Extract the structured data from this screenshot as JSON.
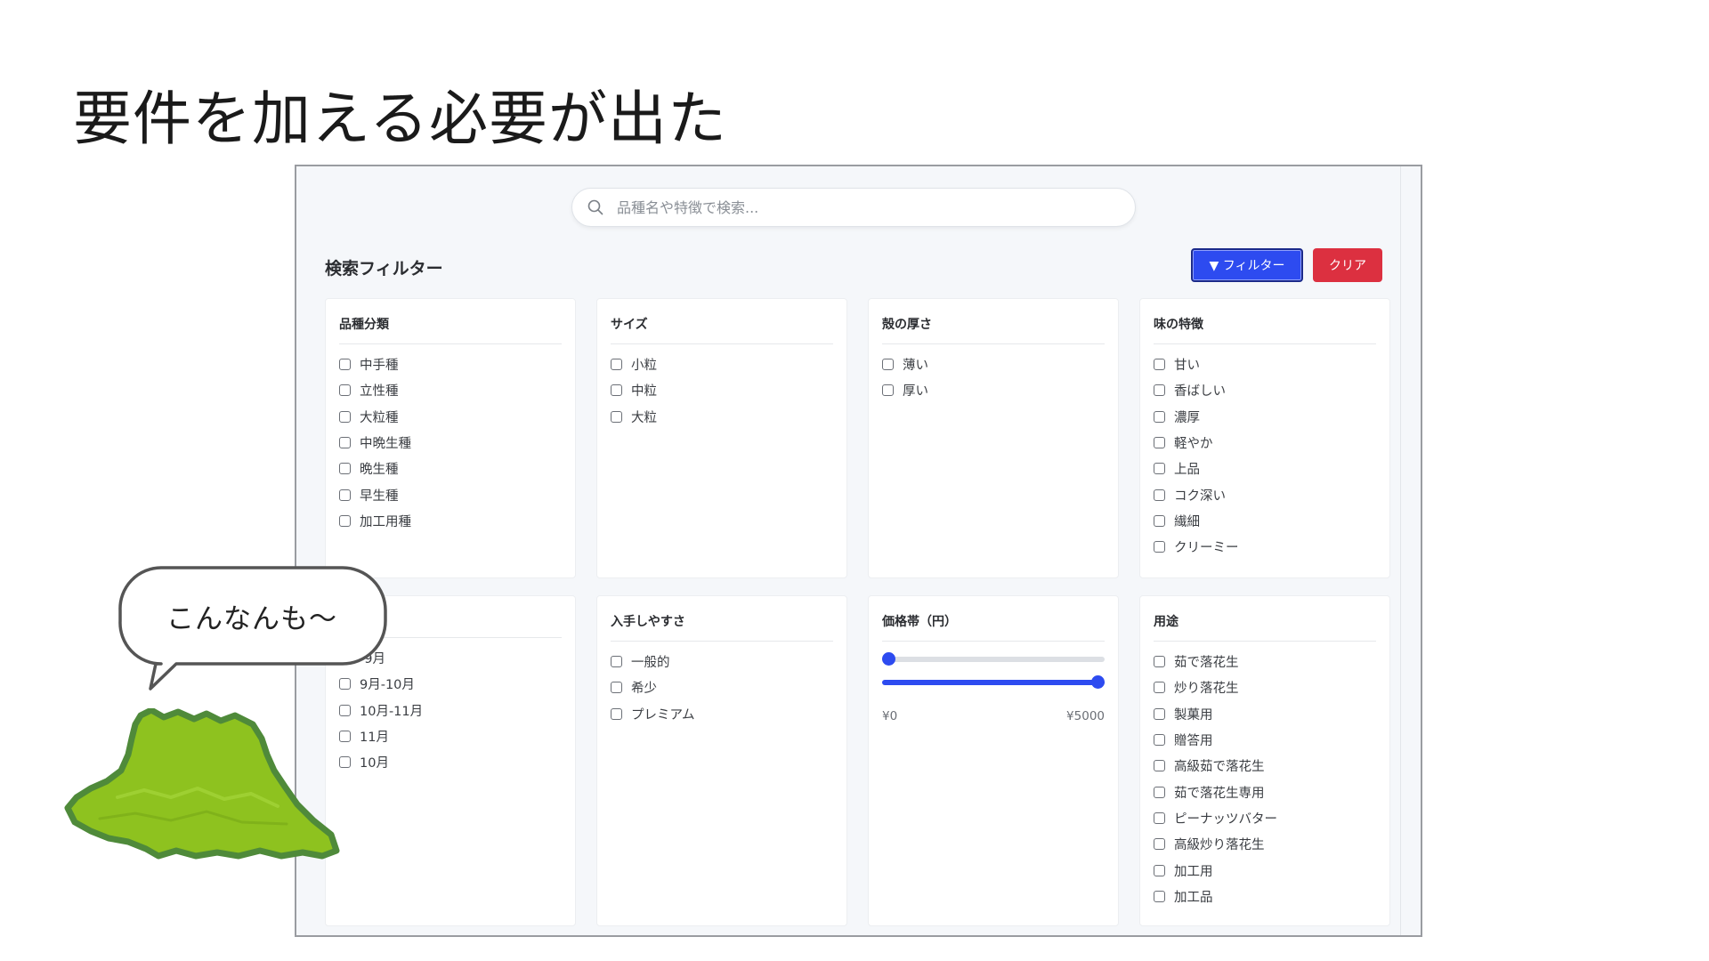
{
  "slide": {
    "title": "要件を加える必要が出た"
  },
  "search": {
    "placeholder": "品種名や特徴で検索..."
  },
  "filters": {
    "heading": "検索フィルター",
    "filter_button": "▼ フィルター",
    "clear_button": "クリア"
  },
  "groups": [
    {
      "title": "品種分類",
      "options": [
        "中手種",
        "立性種",
        "大粒種",
        "中晩生種",
        "晩生種",
        "早生種",
        "加工用種"
      ]
    },
    {
      "title": "サイズ",
      "options": [
        "小粒",
        "中粒",
        "大粒"
      ]
    },
    {
      "title": "殻の厚さ",
      "options": [
        "薄い",
        "厚い"
      ]
    },
    {
      "title": "味の特徴",
      "options": [
        "甘い",
        "香ばしい",
        "濃厚",
        "軽やか",
        "上品",
        "コク深い",
        "繊細",
        "クリーミー"
      ]
    },
    {
      "title": "",
      "options": [
        "-9月",
        "9月-10月",
        "10月-11月",
        "11月",
        "10月"
      ]
    },
    {
      "title": "入手しやすさ",
      "options": [
        "一般的",
        "希少",
        "プレミアム"
      ]
    },
    {
      "title": "用途",
      "options": [
        "茹で落花生",
        "炒り落花生",
        "製菓用",
        "贈答用",
        "高級茹で落花生",
        "茹で落花生専用",
        "ピーナッツバター",
        "高級炒り落花生",
        "加工用",
        "加工品"
      ]
    }
  ],
  "price": {
    "title": "価格帯（円）",
    "min_label": "¥0",
    "max_label": "¥5000",
    "min_value": 0,
    "max_value": 5000
  },
  "bubble": {
    "text": "こんなんも〜"
  },
  "colors": {
    "accent": "#2d4bf0",
    "danger": "#dc3040",
    "land_green": "#8ec21f",
    "land_border": "#4f8a3a"
  }
}
